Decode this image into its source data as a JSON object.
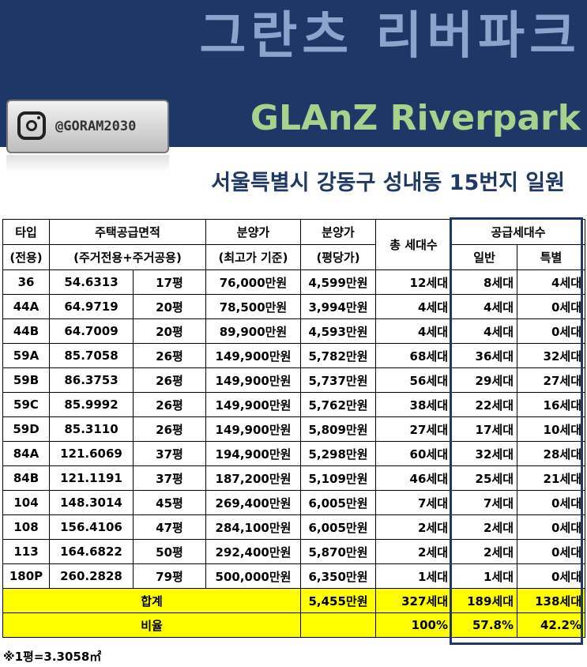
{
  "header": {
    "title_ko": "그란츠 리버파크",
    "title_en": "GLAnZ Riverpark",
    "instagram_handle": "@GORAM2030",
    "address": "서울특별시 강동구 성내동 15번지 일원"
  },
  "colors": {
    "banner": "#1d3766",
    "title_ko": "#8aa4cc",
    "title_en": "#a9d18e",
    "address": "#1f3864",
    "highlight": "#ffff00"
  },
  "table": {
    "headers": {
      "type": "타입",
      "type_sub": "(전용)",
      "area": "주택공급면적",
      "area_sub": "(주거전용+주거공용)",
      "price": "분양가",
      "price_sub": "(최고가 기준)",
      "ppp": "분양가",
      "ppp_sub": "(평당가)",
      "total": "총 세대수",
      "supply": "공급세대수",
      "general": "일반",
      "special": "특별"
    },
    "rows": [
      {
        "type": "36",
        "area": "54.6313",
        "pyeong": "17평",
        "price": "76,000만원",
        "ppp": "4,599만원",
        "total": "12세대",
        "general": "8세대",
        "special": "4세대"
      },
      {
        "type": "44A",
        "area": "64.9719",
        "pyeong": "20평",
        "price": "78,500만원",
        "ppp": "3,994만원",
        "total": "4세대",
        "general": "4세대",
        "special": "0세대"
      },
      {
        "type": "44B",
        "area": "64.7009",
        "pyeong": "20평",
        "price": "89,900만원",
        "ppp": "4,593만원",
        "total": "4세대",
        "general": "4세대",
        "special": "0세대"
      },
      {
        "type": "59A",
        "area": "85.7058",
        "pyeong": "26평",
        "price": "149,900만원",
        "ppp": "5,782만원",
        "total": "68세대",
        "general": "36세대",
        "special": "32세대"
      },
      {
        "type": "59B",
        "area": "86.3753",
        "pyeong": "26평",
        "price": "149,900만원",
        "ppp": "5,737만원",
        "total": "56세대",
        "general": "29세대",
        "special": "27세대"
      },
      {
        "type": "59C",
        "area": "85.9992",
        "pyeong": "26평",
        "price": "149,900만원",
        "ppp": "5,762만원",
        "total": "38세대",
        "general": "22세대",
        "special": "16세대"
      },
      {
        "type": "59D",
        "area": "85.3110",
        "pyeong": "26평",
        "price": "149,900만원",
        "ppp": "5,809만원",
        "total": "27세대",
        "general": "17세대",
        "special": "10세대"
      },
      {
        "type": "84A",
        "area": "121.6069",
        "pyeong": "37평",
        "price": "194,900만원",
        "ppp": "5,298만원",
        "total": "60세대",
        "general": "32세대",
        "special": "28세대"
      },
      {
        "type": "84B",
        "area": "121.1191",
        "pyeong": "37평",
        "price": "187,200만원",
        "ppp": "5,109만원",
        "total": "46세대",
        "general": "25세대",
        "special": "21세대"
      },
      {
        "type": "104",
        "area": "148.3014",
        "pyeong": "45평",
        "price": "269,400만원",
        "ppp": "6,005만원",
        "total": "7세대",
        "general": "7세대",
        "special": "0세대"
      },
      {
        "type": "108",
        "area": "156.4106",
        "pyeong": "47평",
        "price": "284,100만원",
        "ppp": "6,005만원",
        "total": "2세대",
        "general": "2세대",
        "special": "0세대"
      },
      {
        "type": "113",
        "area": "164.6822",
        "pyeong": "50평",
        "price": "292,400만원",
        "ppp": "5,870만원",
        "total": "2세대",
        "general": "2세대",
        "special": "0세대"
      },
      {
        "type": "180P",
        "area": "260.2828",
        "pyeong": "79평",
        "price": "500,000만원",
        "ppp": "6,350만원",
        "total": "1세대",
        "general": "1세대",
        "special": "0세대"
      }
    ],
    "sum": {
      "label": "합계",
      "ppp": "5,455만원",
      "total": "327세대",
      "general": "189세대",
      "special": "138세대"
    },
    "ratio": {
      "label": "비율",
      "total": "100%",
      "general": "57.8%",
      "special": "42.2%"
    }
  },
  "footnote": "※1평=3.3058㎡"
}
